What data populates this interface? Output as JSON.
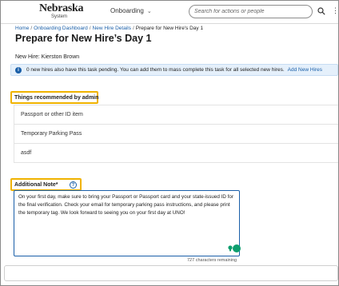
{
  "header": {
    "logo_main": "Nebraska",
    "logo_sub": "System",
    "module_label": "Onboarding",
    "search_placeholder": "Search for actions or people"
  },
  "breadcrumb": {
    "items": [
      "Home",
      "Onboarding Dashboard",
      "New Hire Details"
    ],
    "separator": "/",
    "current": "Prepare for New Hire's Day 1"
  },
  "page": {
    "title": "Prepare for New Hire’s Day 1",
    "new_hire_line": "New Hire: Kierston Brown"
  },
  "banner": {
    "text": "0 new hires also have this task pending. You can add them to mass complete this task for all selected new hires.",
    "link": "Add New Hires"
  },
  "recommended": {
    "label": "Things recommended by admin",
    "items": [
      "Passport or other ID item",
      "Temporary Parking Pass",
      "asdf"
    ]
  },
  "note": {
    "label": "Additional Note",
    "required_mark": "*",
    "help_icon": "?",
    "text": "On your first day, make sure to bring your Passport or Passport card and your state-issued ID for the final verification. Check your email for temporary parking pass instructions, and please print the temporary tag.  We look forward to seeing you on your first day at UNO!",
    "char_count": "727 characters remaining"
  },
  "colors": {
    "link": "#1a5fa8",
    "highlight": "#f0b300",
    "banner_bg": "#e5f0fb",
    "grammar": "#0d9e6e"
  }
}
